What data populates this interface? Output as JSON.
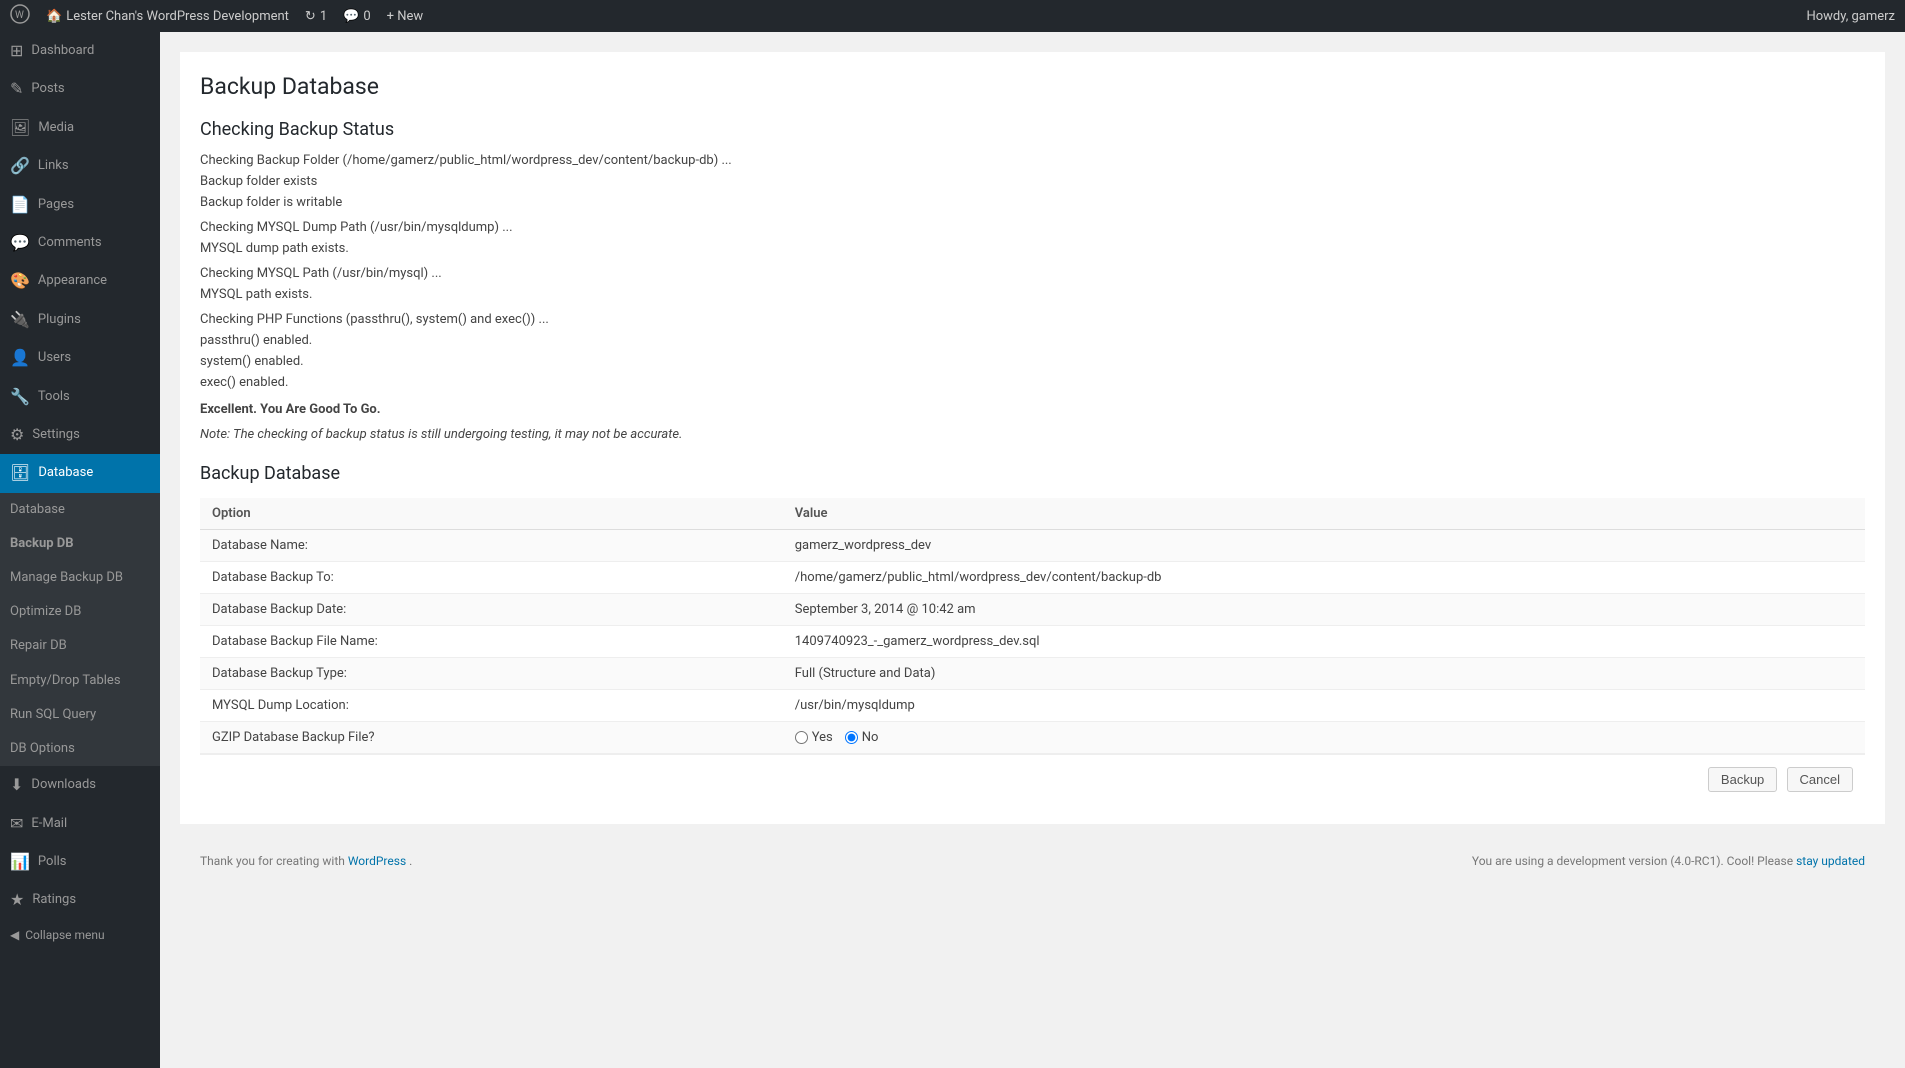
{
  "adminbar": {
    "site_icon": "⚙",
    "site_name": "Lester Chan's WordPress Development",
    "updates_count": "1",
    "comments_count": "0",
    "new_label": "+ New",
    "howdy": "Howdy, gamerz"
  },
  "sidebar": {
    "items": [
      {
        "id": "dashboard",
        "label": "Dashboard",
        "icon": "⊞"
      },
      {
        "id": "posts",
        "label": "Posts",
        "icon": "✎"
      },
      {
        "id": "media",
        "label": "Media",
        "icon": "🖼"
      },
      {
        "id": "links",
        "label": "Links",
        "icon": "🔗"
      },
      {
        "id": "pages",
        "label": "Pages",
        "icon": "📄"
      },
      {
        "id": "comments",
        "label": "Comments",
        "icon": "💬"
      },
      {
        "id": "appearance",
        "label": "Appearance",
        "icon": "🎨"
      },
      {
        "id": "plugins",
        "label": "Plugins",
        "icon": "🔌"
      },
      {
        "id": "users",
        "label": "Users",
        "icon": "👤"
      },
      {
        "id": "tools",
        "label": "Tools",
        "icon": "🔧"
      },
      {
        "id": "settings",
        "label": "Settings",
        "icon": "⚙"
      },
      {
        "id": "database",
        "label": "Database",
        "icon": "🗄"
      },
      {
        "id": "downloads",
        "label": "Downloads",
        "icon": "⬇"
      },
      {
        "id": "email",
        "label": "E-Mail",
        "icon": "✉"
      },
      {
        "id": "polls",
        "label": "Polls",
        "icon": "📊"
      },
      {
        "id": "ratings",
        "label": "Ratings",
        "icon": "★"
      }
    ],
    "database_submenu": [
      {
        "id": "database",
        "label": "Database"
      },
      {
        "id": "backup-db",
        "label": "Backup DB",
        "active": true
      },
      {
        "id": "manage-backup-db",
        "label": "Manage Backup DB"
      },
      {
        "id": "optimize-db",
        "label": "Optimize DB"
      },
      {
        "id": "repair-db",
        "label": "Repair DB"
      },
      {
        "id": "empty-drop-tables",
        "label": "Empty/Drop Tables"
      },
      {
        "id": "run-sql-query",
        "label": "Run SQL Query"
      },
      {
        "id": "db-options",
        "label": "DB Options"
      }
    ],
    "collapse_label": "Collapse menu"
  },
  "main": {
    "page_title": "Backup Database",
    "status_section": {
      "title": "Checking Backup Status",
      "check1_text": "Checking Backup Folder (/home/gamerz/public_html/wordpress_dev/content/backup-db) ...",
      "check1_result1": "Backup folder exists",
      "check1_result2": "Backup folder is writable",
      "check2_text": "Checking MYSQL Dump Path (/usr/bin/mysqldump) ...",
      "check2_result1": "MYSQL dump path exists.",
      "check3_text": "Checking MYSQL Path (/usr/bin/mysql) ...",
      "check3_result1": "MYSQL path exists.",
      "check4_text": "Checking PHP Functions (passthru(), system() and exec()) ...",
      "check4_result1": "passthru() enabled.",
      "check4_result2": "system() enabled.",
      "check4_result3": "exec() enabled.",
      "excellent": "Excellent. You Are Good To Go.",
      "note": "Note: The checking of backup status is still undergoing testing, it may not be accurate."
    },
    "backup_section": {
      "title": "Backup Database",
      "table_headers": [
        "Option",
        "Value"
      ],
      "rows": [
        {
          "option": "Database Name:",
          "value": "gamerz_wordpress_dev"
        },
        {
          "option": "Database Backup To:",
          "value": "/home/gamerz/public_html/wordpress_dev/content/backup-db"
        },
        {
          "option": "Database Backup Date:",
          "value": "September 3, 2014 @ 10:42 am"
        },
        {
          "option": "Database Backup File Name:",
          "value": "1409740923_-_gamerz_wordpress_dev.sql"
        },
        {
          "option": "Database Backup Type:",
          "value": "Full (Structure and Data)"
        },
        {
          "option": "MYSQL Dump Location:",
          "value": "/usr/bin/mysqldump"
        }
      ],
      "gzip_label": "GZIP Database Backup File?",
      "gzip_yes": "Yes",
      "gzip_no": "No",
      "backup_button": "Backup",
      "cancel_button": "Cancel"
    }
  },
  "footer": {
    "thank_you": "Thank you for creating with ",
    "wordpress_link": "WordPress",
    "version_note": "You are using a development version (4.0-RC1). Cool! Please ",
    "stay_updated_link": "stay updated"
  }
}
